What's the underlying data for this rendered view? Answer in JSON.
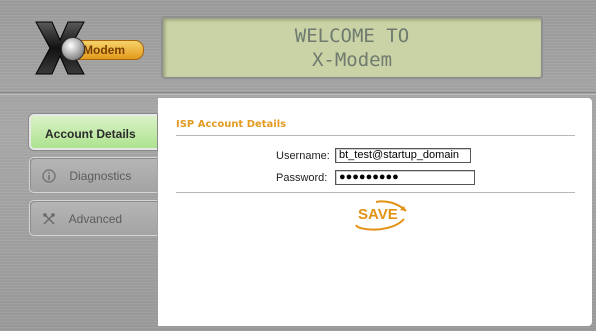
{
  "logo": {
    "text": "Modem",
    "letter": "X"
  },
  "lcd": {
    "line1": "WELCOME TO",
    "line2": "X-Modem"
  },
  "sidebar": {
    "items": [
      {
        "label": "Account Details",
        "icon": "none",
        "active": true
      },
      {
        "label": "Diagnostics",
        "icon": "info-icon",
        "active": false
      },
      {
        "label": "Advanced",
        "icon": "tools-icon",
        "active": false
      }
    ]
  },
  "main": {
    "section_title": "ISP Account Details",
    "username_label": "Username:",
    "username_value": "bt_test@startup_domain",
    "password_label": "Password:",
    "password_value": "●●●●●●●●●",
    "save_label": "SAVE"
  },
  "colors": {
    "accent": "#e39b22",
    "active_tab": "#aee38f",
    "lcd_bg": "#c9d3a6",
    "lcd_text": "#6f7b6f"
  }
}
